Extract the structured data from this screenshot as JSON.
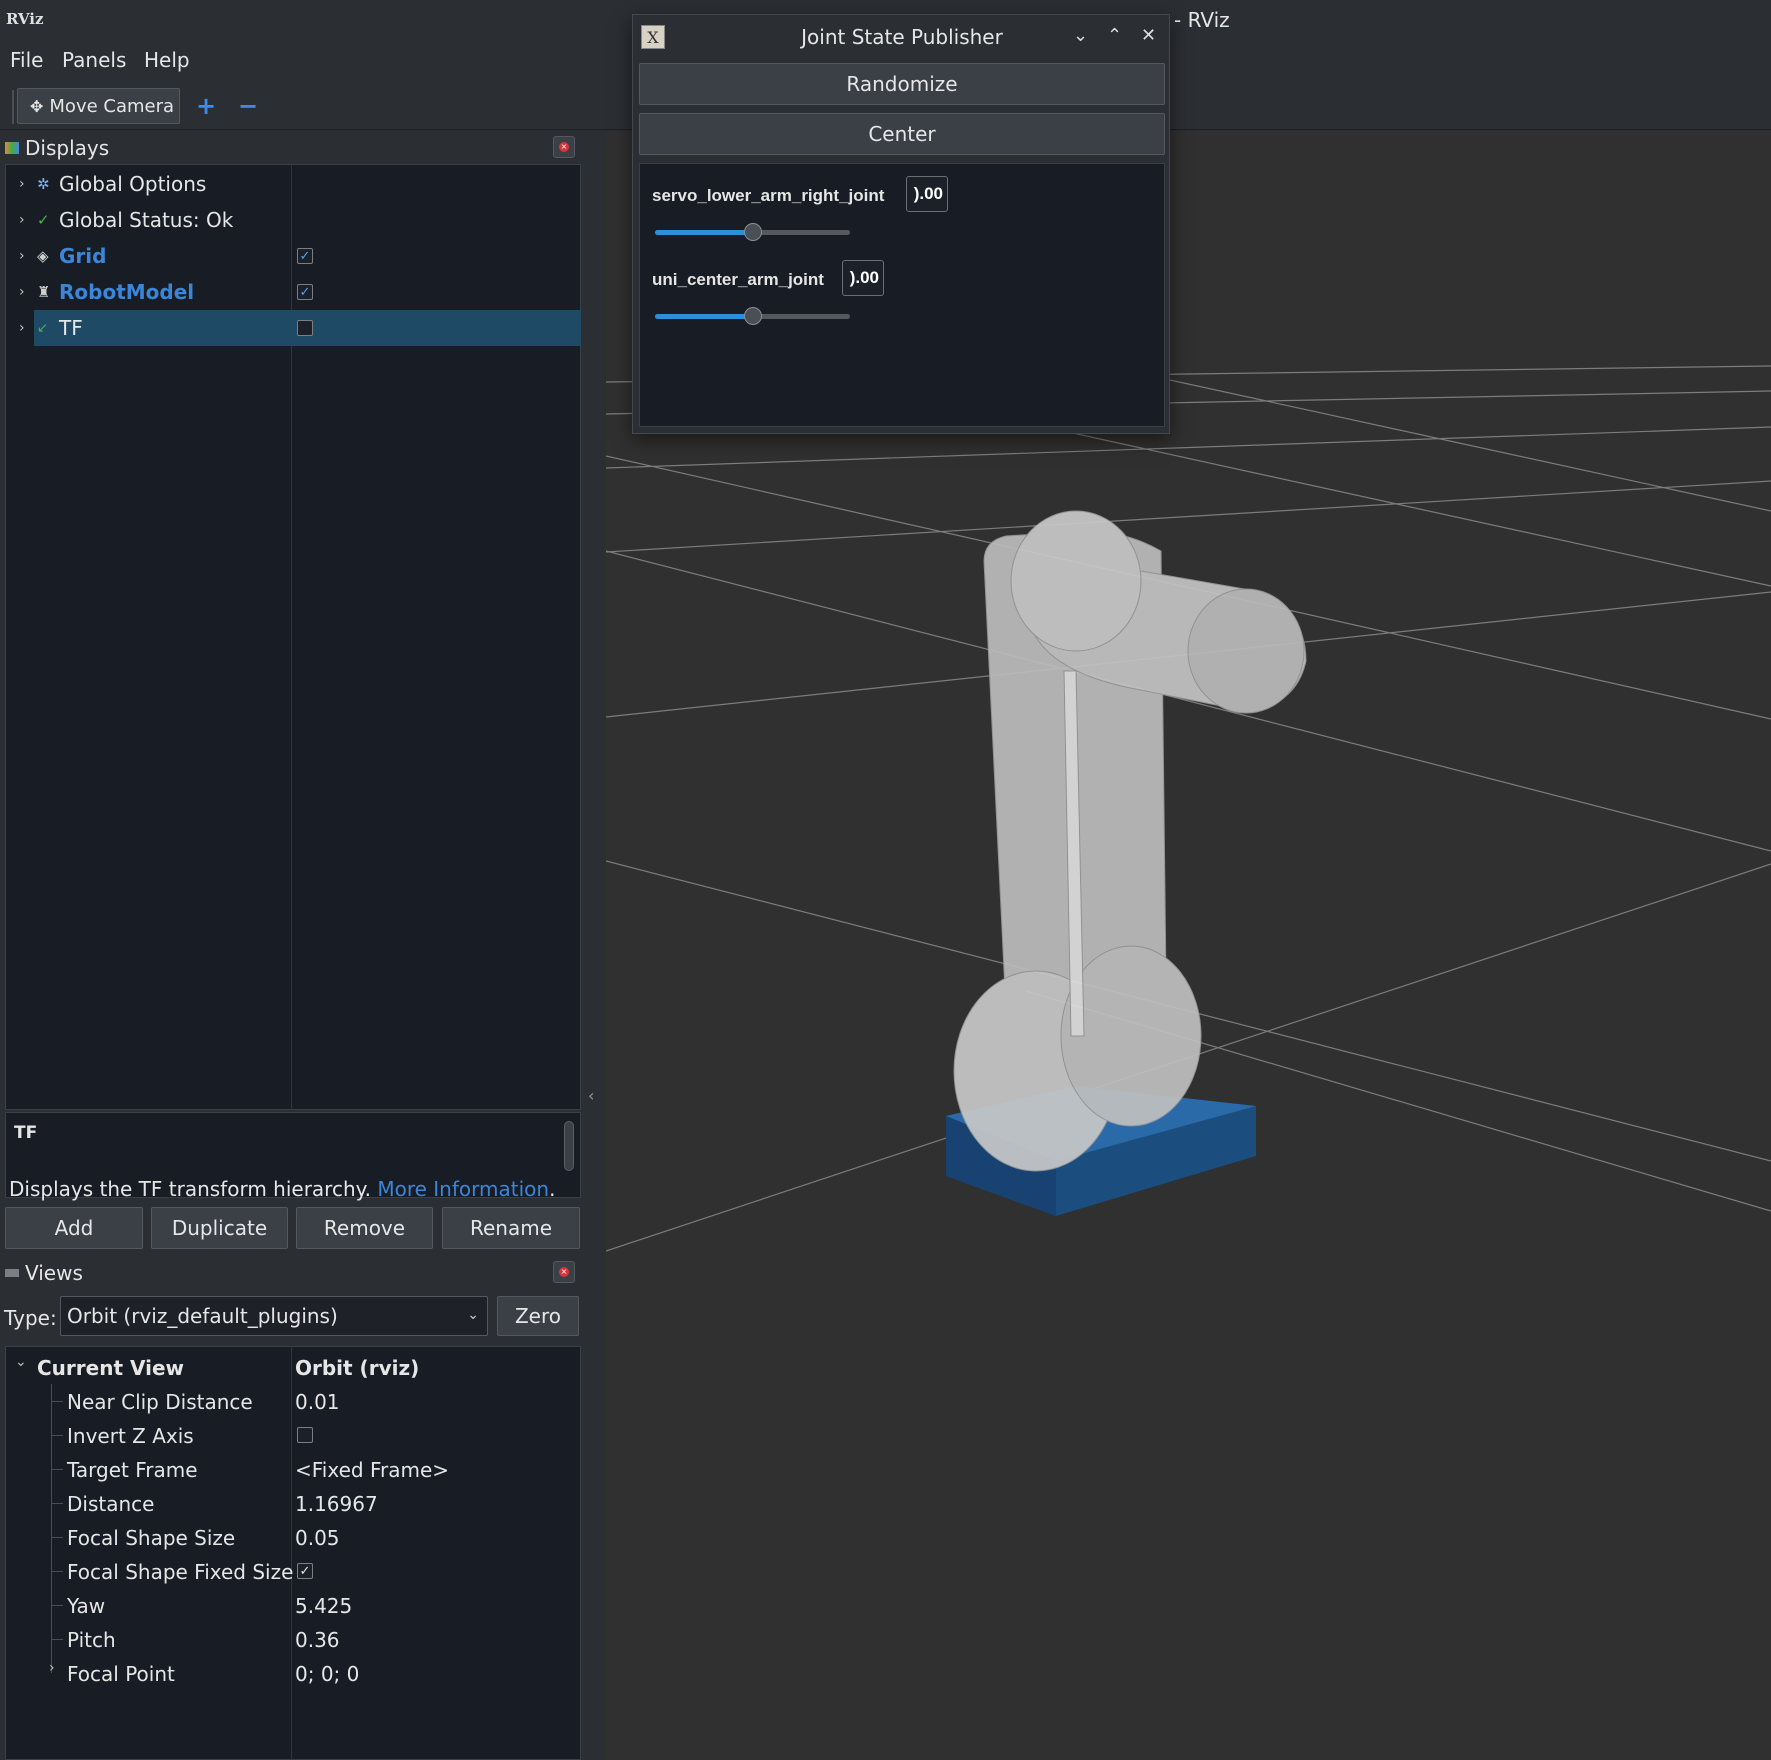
{
  "window": {
    "title": "- RViz",
    "logo": "RViz"
  },
  "menu": [
    "File",
    "Panels",
    "Help"
  ],
  "toolbar": {
    "move_camera": "Move Camera",
    "move_icon": "move-icon",
    "plus": "+",
    "minus": "−"
  },
  "displays": {
    "title": "Displays",
    "items": [
      {
        "label": "Global Options",
        "icon": "gear-icon",
        "checked": null
      },
      {
        "label": "Global Status: Ok",
        "icon": "check-icon",
        "checked": null
      },
      {
        "label": "Grid",
        "icon": "grid-icon",
        "checked": true
      },
      {
        "label": "RobotModel",
        "icon": "robot-icon",
        "checked": true
      },
      {
        "label": "TF",
        "icon": "tf-icon",
        "checked": false
      }
    ],
    "description": {
      "title": "TF",
      "text": "Displays the TF transform hierarchy. ",
      "link": "More Information",
      "suffix": "."
    },
    "buttons": {
      "add": "Add",
      "duplicate": "Duplicate",
      "remove": "Remove",
      "rename": "Rename"
    }
  },
  "views": {
    "title": "Views",
    "type_label": "Type:",
    "type_value": "Orbit (rviz_default_plugins)",
    "zero": "Zero",
    "current_view": {
      "label": "Current View",
      "value": "Orbit (rviz)"
    },
    "props": [
      {
        "label": "Near Clip Distance",
        "value": "0.01"
      },
      {
        "label": "Invert Z Axis",
        "value": ""
      },
      {
        "label": "Target Frame",
        "value": "<Fixed Frame>"
      },
      {
        "label": "Distance",
        "value": "1.16967"
      },
      {
        "label": "Focal Shape Size",
        "value": "0.05"
      },
      {
        "label": "Focal Shape Fixed Size",
        "value": ""
      },
      {
        "label": "Yaw",
        "value": "5.425"
      },
      {
        "label": "Pitch",
        "value": "0.36"
      },
      {
        "label": "Focal Point",
        "value": "0; 0; 0"
      }
    ]
  },
  "jsp": {
    "title": "Joint State Publisher",
    "randomize": "Randomize",
    "center": "Center",
    "joints": [
      {
        "name": "servo_lower_arm_right_joint",
        "value": ").00",
        "fraction": 0.5
      },
      {
        "name": "uni_center_arm_joint",
        "value": ").00",
        "fraction": 0.5
      }
    ]
  },
  "colors": {
    "accent": "#3a86d8",
    "selection": "#1f4a66",
    "base_blue": "#1f5a8f"
  }
}
